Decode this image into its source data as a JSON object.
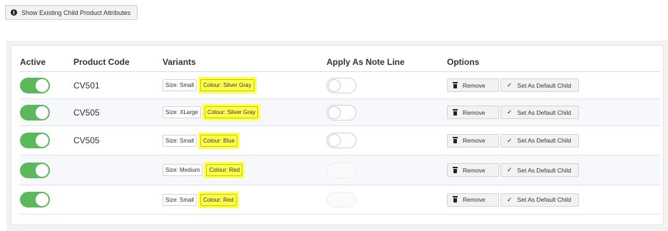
{
  "top_button": {
    "label": "Show Existing Child Product Attributes",
    "icon": "info-icon"
  },
  "table": {
    "headers": {
      "active": "Active",
      "code": "Product Code",
      "variants": "Variants",
      "note": "Apply As Note Line",
      "options": "Options"
    },
    "rows": [
      {
        "active": true,
        "code": "CV501",
        "size": "Size: Small",
        "colour": "Colour: Silver Gray",
        "note_line": "off"
      },
      {
        "active": true,
        "code": "CV505",
        "size": "Size: XLarge",
        "colour": "Colour: Silver Gray",
        "note_line": "off"
      },
      {
        "active": true,
        "code": "CV505",
        "size": "Size: Small",
        "colour": "Colour: Blue",
        "note_line": "off"
      },
      {
        "active": true,
        "code": "",
        "size": "Size: Medium",
        "colour": "Colour: Red",
        "note_line": "disabled"
      },
      {
        "active": true,
        "code": "",
        "size": "Size: Small",
        "colour": "Colour: Red",
        "note_line": "disabled"
      }
    ],
    "options": {
      "remove_label": "Remove",
      "default_label": "Set As Default Child"
    }
  },
  "colors": {
    "toggle_on": "#5cb85c",
    "highlight": "#ffff4d"
  }
}
